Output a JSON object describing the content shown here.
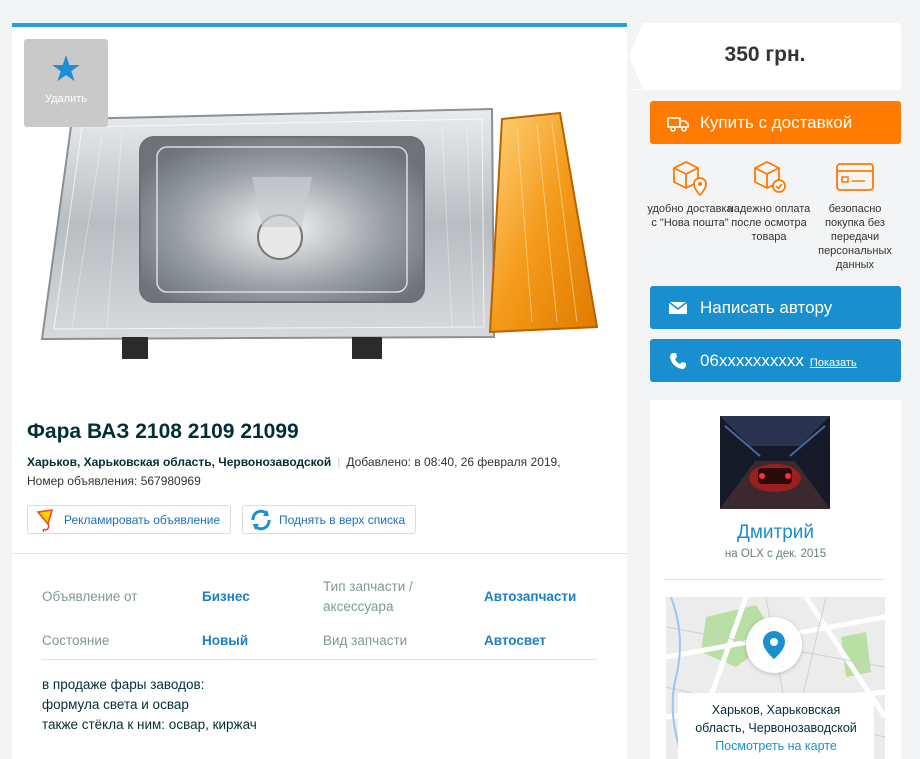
{
  "favorite": {
    "label": "Удалить"
  },
  "listing": {
    "title": "Фара ВАЗ 2108 2109 21099",
    "location": "Харьков, Харьковская область, Червонозаводской",
    "added": "Добавлено: в 08:40, 26 февраля 2019,",
    "number": "Номер объявления: 567980969",
    "promote_label": "Рекламировать объявление",
    "bump_label": "Поднять в верх списка"
  },
  "params": [
    {
      "key": "Объявление от",
      "value": "Бизнес"
    },
    {
      "key": "Тип запчасти / аксессуара",
      "value": "Автозапчасти"
    },
    {
      "key": "Состояние",
      "value": "Новый"
    },
    {
      "key": "Вид запчасти",
      "value": "Автосвет"
    }
  ],
  "description": [
    "в продаже фары заводов:",
    "формула света и освар",
    "также стёкла к ним: освар, киржач"
  ],
  "sidebar": {
    "price": "350 грн.",
    "buy_label": "Купить с доставкой",
    "features": [
      {
        "text": "удобно доставка с \"Нова пошта\"",
        "icon": "box-pin-icon"
      },
      {
        "text": "надежно оплата после осмотра товара",
        "icon": "box-check-icon"
      },
      {
        "text": "безопасно покупка без передачи персональных данных",
        "icon": "card-icon"
      }
    ],
    "write_label": "Написать автору",
    "phone": "06xxxxxxxxxx",
    "show_label": "Показать"
  },
  "seller": {
    "name": "Дмитрий",
    "since": "на OLX с дек. 2015",
    "map_location_line1": "Харьков, Харьковская",
    "map_location_line2": "область, Червонозаводской",
    "map_link": "Посмотреть на карте"
  },
  "colors": {
    "accent_blue": "#1a8fcf",
    "buy_orange": "#ff7a00"
  }
}
